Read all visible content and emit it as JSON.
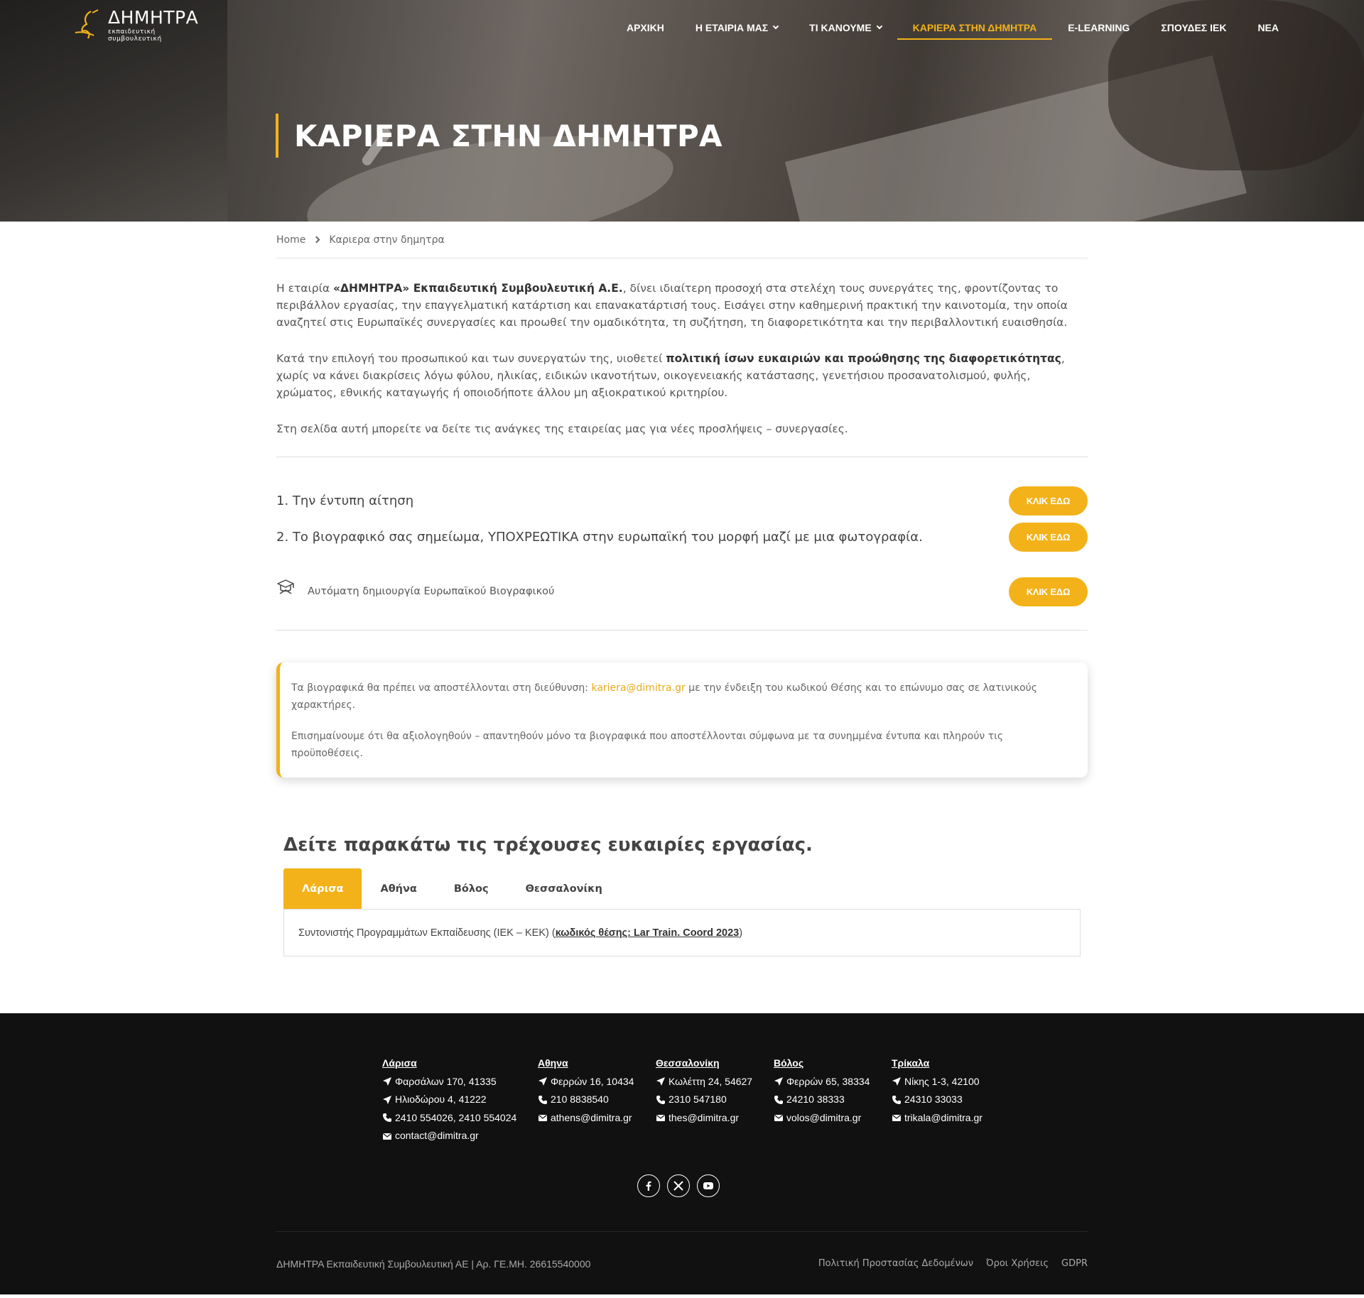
{
  "brand": {
    "name": "ΔΗΜΗΤΡΑ",
    "tagline": "εκπαιδευτική συμβουλευτική",
    "accent_color": "#f3b21a"
  },
  "nav": {
    "items": [
      {
        "label": "ΑΡΧΙΚΗ",
        "dropdown": false,
        "active": false
      },
      {
        "label": "Η ΕΤΑΙΡΙΑ ΜΑΣ",
        "dropdown": true,
        "active": false
      },
      {
        "label": "ΤΙ ΚΑΝΟΥΜΕ",
        "dropdown": true,
        "active": false
      },
      {
        "label": "ΚΑΡΙΕΡΑ ΣΤΗΝ ΔΗΜΗΤΡΑ",
        "dropdown": false,
        "active": true
      },
      {
        "label": "E-LEARNING",
        "dropdown": false,
        "active": false
      },
      {
        "label": "ΣΠΟΥΔΕΣ ΙΕΚ",
        "dropdown": false,
        "active": false
      },
      {
        "label": "ΝΕΑ",
        "dropdown": false,
        "active": false
      }
    ]
  },
  "hero": {
    "title": "ΚΑΡΙΕΡΑ ΣΤΗΝ ΔΗΜΗΤΡΑ"
  },
  "breadcrumb": {
    "home": "Home",
    "current": "Καριερα στην δημητρα"
  },
  "intro": {
    "p1_a": "Η εταιρία ",
    "p1_b": "«ΔΗΜΗΤΡΑ» Εκπαιδευτική Συμβουλευτική Α.Ε.",
    "p1_c": ", δίνει ιδιαίτερη προσοχή στα στελέχη τους συνεργάτες της, φροντίζοντας το περιβάλλον εργασίας, την επαγγελματική κατάρτιση και επανακατάρτισή τους. Εισάγει στην καθημερινή πρακτική την καινοτομία, την οποία αναζητεί στις Ευρωπαϊκές συνεργασίες και προωθεί την ομαδικότητα, τη συζήτηση, τη διαφορετικότητα και την περιβαλλοντική ευαισθησία.",
    "p2_a": "Κατά την επιλογή του προσωπικού και των συνεργατών της, υιοθετεί ",
    "p2_b": "πολιτική ίσων ευκαιριών και προώθησης της διαφορετικότητας",
    "p2_c": ", χωρίς να κάνει διακρίσεις λόγω φύλου, ηλικίας, ειδικών ικανοτήτων, οικογενειακής κατάστασης, γενετήσιου προσανατολισμού, φυλής, χρώματος, εθνικής καταγωγής ή οποιοδήποτε άλλου μη αξιοκρατικού κριτηρίου.",
    "p3": "Στη σελίδα αυτή μπορείτε να δείτε τις ανάγκες της εταιρείας μας για νέες προσλήψεις – συνεργασίες."
  },
  "apply": {
    "item1": "1. Την έντυπη αίτηση",
    "item2": "2. Το βιογραφικό σας σημείωμα, ΥΠΟΧΡΕΩΤΙΚΑ στην ευρωπαϊκή του μορφή μαζί με μια φωτογραφία.",
    "ecv": "Αυτόματη δημιουργία Ευρωπαϊκού Βιογραφικού",
    "button_label": "ΚΛΙΚ ΕΔΩ"
  },
  "notice": {
    "p1_a": "Τα βιογραφικά θα πρέπει να αποστέλλονται στη διεύθυνση: ",
    "email": "kariera@dimitra.gr",
    "p1_b": " με την ένδειξη του κωδικού Θέσης και το επώνυμο σας σε λατινικούς χαρακτήρες.",
    "p2": "Επισημαίνουμε ότι θα αξιολογηθούν – απαντηθούν μόνο τα βιογραφικά που αποστέλλονται σύμφωνα με τα συνημμένα έντυπα και πληρούν τις προϋποθέσεις."
  },
  "jobs": {
    "heading": "Δείτε παρακάτω τις τρέχουσες ευκαιρίες εργασίας.",
    "tabs": [
      "Λάρισα",
      "Αθήνα",
      "Βόλος",
      "Θεσσαλονίκη"
    ],
    "active_tab": "Λάρισα",
    "listing_a": "Συντονιστής Προγραμμάτων Εκπαίδευσης (ΙΕΚ – ΚΕΚ) (",
    "listing_code": "κωδικός θέσης: Lar Train. Coord 2023",
    "listing_b": ")"
  },
  "footer": {
    "columns": [
      {
        "title": "Λάρισα",
        "lines": [
          {
            "icon": "location-arrow-icon",
            "text": "Φαρσάλων 170, 41335"
          },
          {
            "icon": "location-arrow-icon",
            "text": "Ηλιοδώρου 4, 41222"
          },
          {
            "icon": "phone-icon",
            "text": "2410 554026, 2410 554024"
          },
          {
            "icon": "envelope-icon",
            "text": "contact@dimitra.gr"
          }
        ]
      },
      {
        "title": "Αθηνα",
        "lines": [
          {
            "icon": "location-arrow-icon",
            "text": "Φερρών 16, 10434"
          },
          {
            "icon": "phone-icon",
            "text": "210 8838540"
          },
          {
            "icon": "envelope-icon",
            "text": "athens@dimitra.gr"
          }
        ]
      },
      {
        "title": "Θεσσαλονίκη",
        "lines": [
          {
            "icon": "location-arrow-icon",
            "text": "Κωλέττη 24, 54627"
          },
          {
            "icon": "phone-icon",
            "text": "2310 547180"
          },
          {
            "icon": "envelope-icon",
            "text": "thes@dimitra.gr"
          }
        ]
      },
      {
        "title": "Βόλος",
        "lines": [
          {
            "icon": "location-arrow-icon",
            "text": "Φερρών 65, 38334"
          },
          {
            "icon": "phone-icon",
            "text": "24210 38333"
          },
          {
            "icon": "envelope-icon",
            "text": "volos@dimitra.gr"
          }
        ]
      },
      {
        "title": "Τρίκαλα",
        "lines": [
          {
            "icon": "location-arrow-icon",
            "text": "Νίκης 1-3, 42100"
          },
          {
            "icon": "phone-icon",
            "text": "24310 33033"
          },
          {
            "icon": "envelope-icon",
            "text": "trikala@dimitra.gr"
          }
        ]
      }
    ],
    "socials": [
      "facebook-icon",
      "x-twitter-icon",
      "youtube-icon"
    ],
    "copyright": "ΔΗΜΗΤΡΑ Εκπαιδευτική Συμβουλευτική ΑΕ | Αρ. ΓΕ.ΜΗ. 26615540000",
    "legal": [
      "Πολιτική Προστασίας Δεδομένων",
      "Όροι Χρήσεις",
      "GDPR"
    ]
  }
}
